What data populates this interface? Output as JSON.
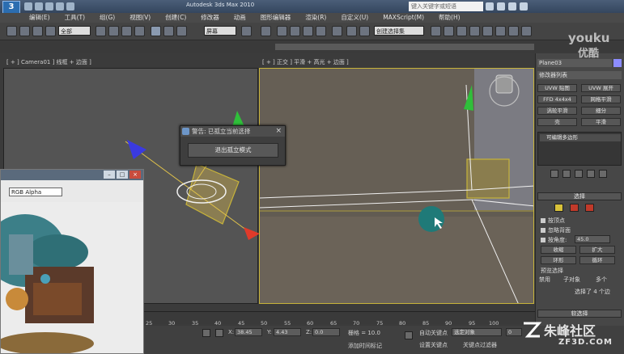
{
  "app": {
    "logo": "3",
    "window_title": "Autodesk 3ds Max 2010",
    "search_placeholder": "键入关键字或短语"
  },
  "menu": [
    "编辑(E)",
    "工具(T)",
    "组(G)",
    "视图(V)",
    "创建(C)",
    "修改器",
    "动画",
    "图形编辑器",
    "渲染(R)",
    "自定义(U)",
    "MAXScript(M)",
    "帮助(H)"
  ],
  "toolbar": {
    "filter_select": "全部",
    "view_select": "屏幕",
    "named_sel": "创建选择集"
  },
  "viewports": {
    "left_label": "[ + ] Camera01 ] 线框 + 边面 ]",
    "right_label": "[ + ] 正交 ] 平滑 + 高光 + 边面 ]"
  },
  "dialog": {
    "title": "警告: 已孤立当前选择",
    "button": "退出孤立模式"
  },
  "render_window": {
    "channel": "RGB Alpha"
  },
  "command_panel": {
    "object_name": "Plane03",
    "modifier_list": "修改器列表",
    "modifier_buttons": [
      "UVW 贴图",
      "UVW 展开",
      "FFD 4x4x4",
      "网格平滑",
      "涡轮平滑",
      "细分",
      "壳",
      "平滑"
    ],
    "stack_item": "可编辑多边形",
    "selection_title": "选择",
    "checkboxes": [
      "按顶点",
      "忽略背面",
      "按角度:"
    ],
    "angle_value": "45.0",
    "buttons": {
      "shrink": "收缩",
      "grow": "扩大",
      "ring": "环形",
      "loop": "循环"
    },
    "preview_label": "预览选择",
    "preview_options": [
      "禁用",
      "子对象",
      "多个"
    ],
    "status": "选择了 4 个边",
    "soft_selection": "软选择"
  },
  "timeline": {
    "ticks": [
      "25",
      "30",
      "35",
      "40",
      "45",
      "50",
      "55",
      "60",
      "65",
      "70",
      "75",
      "80",
      "85",
      "90",
      "95",
      "100"
    ]
  },
  "statusbar": {
    "x_value": "38.45",
    "y_value": "4.43",
    "z_value": "0.0",
    "grid": "栅格 = 10.0",
    "auto_key": "自动关键点",
    "set_key": "设置关键点",
    "sel_object": "选定对象",
    "key_filters": "关键点过滤器",
    "add_time_tag": "添加时间标记",
    "frame": "0"
  },
  "watermarks": {
    "youku": "youku",
    "youku_cn": "优酷",
    "zhufeng": "朱峰社区",
    "zf3d": "ZF3D.COM"
  },
  "colors": {
    "selection_yellow": "#c7b33a",
    "axis_red": "#e03a2a",
    "axis_green": "#2fbf3a",
    "axis_blue": "#3a3ae0",
    "cursor_teal": "#1f7a78"
  }
}
